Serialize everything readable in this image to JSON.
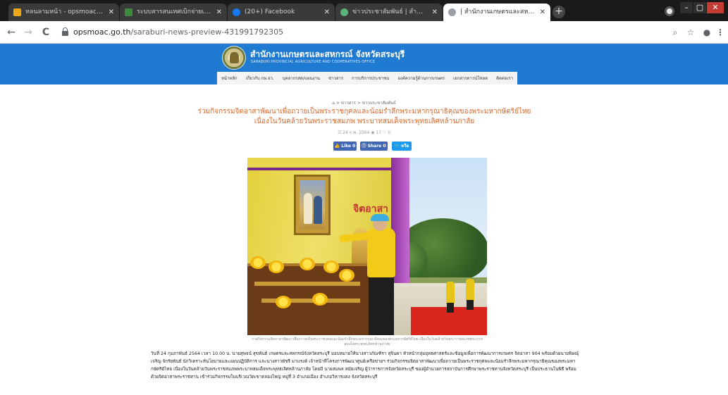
{
  "browser": {
    "tabs": [
      {
        "title": "หลนลามหน้า - opsmoac.go.th - Sm",
        "favicon_color": "#f0a814",
        "active": false
      },
      {
        "title": "ระบบสารสนเทศเบิกจ่ายเงินคดีพิจารณา",
        "favicon_color": "#3c8a3c",
        "active": false
      },
      {
        "title": "(20+) Facebook",
        "favicon_color": "#1877f2",
        "active": false
      },
      {
        "title": "ข่าวประชาสัมพันธ์ | สำนักงานเกษตรฯ",
        "favicon_color": "#58b47a",
        "active": false
      },
      {
        "title": "| สำนักงานเกษตรและสหกรณ์ จังหวัด",
        "favicon_color": "#9aa0a6",
        "active": true
      }
    ],
    "new_tab_label": "+",
    "close_glyph": "✕",
    "window_controls": {
      "minimize": "–",
      "maximize": "▢",
      "close": "✕"
    },
    "nav": {
      "back": "←",
      "forward": "→",
      "reload": "C"
    },
    "url": {
      "host": "opsmoac.go.th",
      "path": "/saraburi-news-preview-431991792305"
    },
    "toolbar_icons": [
      "zoom-icon",
      "star-icon",
      "account-icon",
      "menu-icon"
    ],
    "toolbar_glyphs": {
      "zoom": "⌕",
      "star": "☆",
      "account": "●",
      "menu": "⋮"
    }
  },
  "site": {
    "name": "สำนักงานเกษตรและสหกรณ์ จังหวัดสระบุรี",
    "subtitle": "SARABURI PROVINCIAL AGRICULTURE AND COOPERATIVES OFFICE",
    "brand_color": "#1f7ad1",
    "nav": [
      "หน้าหลัก",
      "เกี่ยวกับ กษ.จว.",
      "บุคลากรสด/แผนงาน",
      "ข่าวสาร",
      "การบริการประชาชน",
      "องค์ความรู้ด้านการเกษตร",
      "เอกสารดาวน์โหลด",
      "ติดต่อเรา"
    ]
  },
  "article": {
    "breadcrumb": "⌂ > ข่าวสาร > ข่าวประชาสัมพันธ์",
    "title": "ร่วมกิจกรรมจิตอาสาพัฒนาเพื่อถวายเป็นพระราชกุศลและน้อมรำลึกพระมหากรุณาธิคุณของพระมหากษัตริย์ไทย เนื่องในวันคล้ายวันพระราชสมภพ พระบาทสมเด็จพระพุทธเลิศหล้านภาลัย",
    "title_color": "#d9682c",
    "meta": "☷ 24 ก.พ. 2564   ◉ 17   ♡ 0",
    "share_buttons": {
      "like": "👍 Like 0",
      "share": "ⓕ Share 0",
      "tweet": "🐦 ทวีต"
    },
    "photo_banner_text": "จิตอาสา",
    "caption": "ร่วมกิจกรรมจิตอาสาพัฒนาเพื่อถวายเป็นพระราชกุศลและน้อมรำลึกพระมหากรุณาธิคุณของพระมหากษัตริย์ไทย เนื่องในวันคล้ายวันพระราชสมภพพระบาทสมเด็จพระพุทธเลิศหล้านภาลัย",
    "body": "วันที่ 24 กุมภาพันธ์ 2564 เวลา 10.00 น. นายสุพจน์ สุขพันธ์ เกษตรและสหกรณ์จังหวัดสระบุรี มอบหมายให้นางสาวภัณฑิรา สุจินดา หัวหน้ากลุ่มยุทธศาสตร์และข้อมูลเพื่อการพัฒนาการเกษตร จิตอาสา 904 พร้อมด้วยนายพิษณุ์ เจริญ จักรัยพันธ์ นักวิเคราะห์นโยบายและแผนปฏิบัติการ และนางสาวพัชรี มาแรงค์ เจ้าหน้าที่โครงการพัฒนาศูนย์เครือข่ายฯ ร่วมกิจกรรมจิตอาสาพัฒนาเพื่อถวายเป็นพระราชกุศลและน้อมรำลึกพระมหากรุณาธิคุณของพระมหากษัตริย์ไทย เนื่องในวันคล้ายวันพระราชสมภพพระบาทสมเด็จพระพุทธเลิศหล้านภาลัย โดยมี นายสมพล สมัยเจริญ ผู้ว่าราชการจังหวัดสระบุรี ของผู้อำนวยการสถาบันการศึกษาพระราชทานจังหวัดสระบุรี เป็นประธานในพิธี พร้อมด้วยจิตอาสาพระราชทาน เข้าร่วมกิจกรรมในบริเวณวัดเขาคลองใหญ่ หมู่ที่ 3 อำเภอเมือง อำเภอวิหารแดง จังหวัดสระบุรี"
  }
}
